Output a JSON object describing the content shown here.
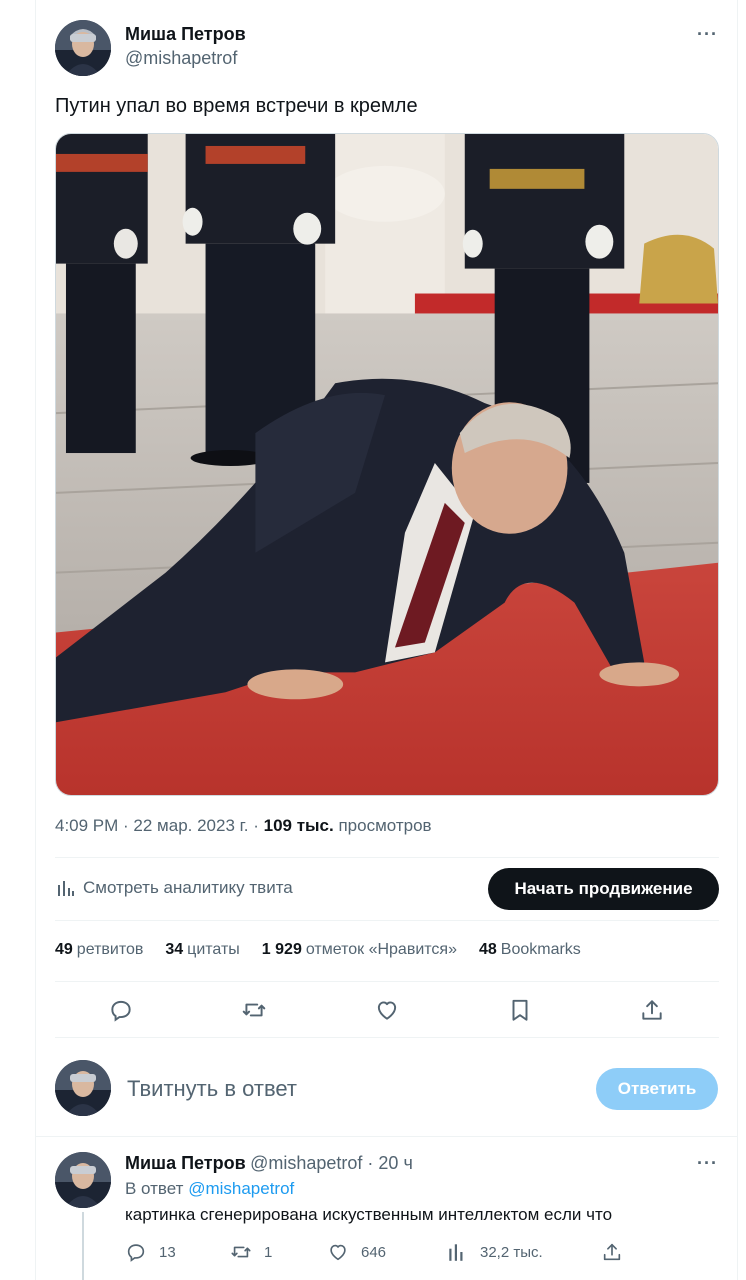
{
  "tweet": {
    "author_name": "Миша Петров",
    "author_handle": "@mishapetrof",
    "more_glyph": "···",
    "text": "Путин упал во время встречи в кремле",
    "time": "4:09 PM · 22 мар. 2023 г. ·",
    "views_count": "109 тыс.",
    "views_label": "просмотров"
  },
  "analytics": {
    "label": "Смотреть аналитику твита",
    "promote_label": "Начать продвижение"
  },
  "stats": [
    {
      "count": "49",
      "label": "ретвитов"
    },
    {
      "count": "34",
      "label": "цитаты"
    },
    {
      "count": "1 929",
      "label": "отметок «Нравится»"
    },
    {
      "count": "48",
      "label": "Bookmarks"
    }
  ],
  "compose": {
    "placeholder": "Твитнуть в ответ",
    "button_label": "Ответить"
  },
  "reply": {
    "author_name": "Миша Петров",
    "meta": "@mishapetrof · 20 ч",
    "more_glyph": "···",
    "reply_to_prefix": "В ответ",
    "reply_to_handle": "@mishapetrof",
    "text": "картинка сгенерирована искуственным интеллектом если что",
    "replies": "13",
    "retweets": "1",
    "likes": "646",
    "views": "32,2 тыс."
  },
  "icons": {
    "reply": "reply-icon",
    "retweet": "retweet-icon",
    "like": "heart-icon",
    "bookmark": "bookmark-icon",
    "share": "share-icon",
    "analytics": "bar-chart-icon"
  },
  "colors": {
    "accent": "#1d9bf0",
    "promote_bg": "#0f1419",
    "reply_btn_bg": "#8ecdf8",
    "muted": "#536471"
  }
}
